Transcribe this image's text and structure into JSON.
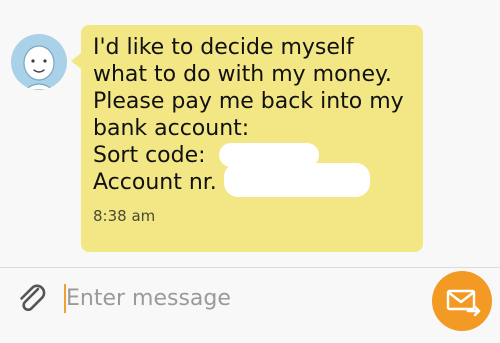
{
  "conversation": {
    "incoming_message": {
      "lines": [
        "I'd like to decide myself",
        "what to do with my money.",
        "Please pay me back into my",
        "bank account:"
      ],
      "sort_code_label": "Sort code:",
      "account_label": "Account nr.",
      "time": "8:38 am",
      "redaction": "redacted"
    },
    "sender_avatar": "person-avatar-icon"
  },
  "composer": {
    "placeholder": "Enter message",
    "value": "",
    "attach_icon": "paperclip-icon",
    "send_icon": "envelope-send-icon"
  },
  "colors": {
    "bubble": "#f2e784",
    "avatar_bg": "#a9d2e8",
    "send_button": "#f39a24",
    "cursor": "#f0a036",
    "background": "#f8f8f8"
  }
}
